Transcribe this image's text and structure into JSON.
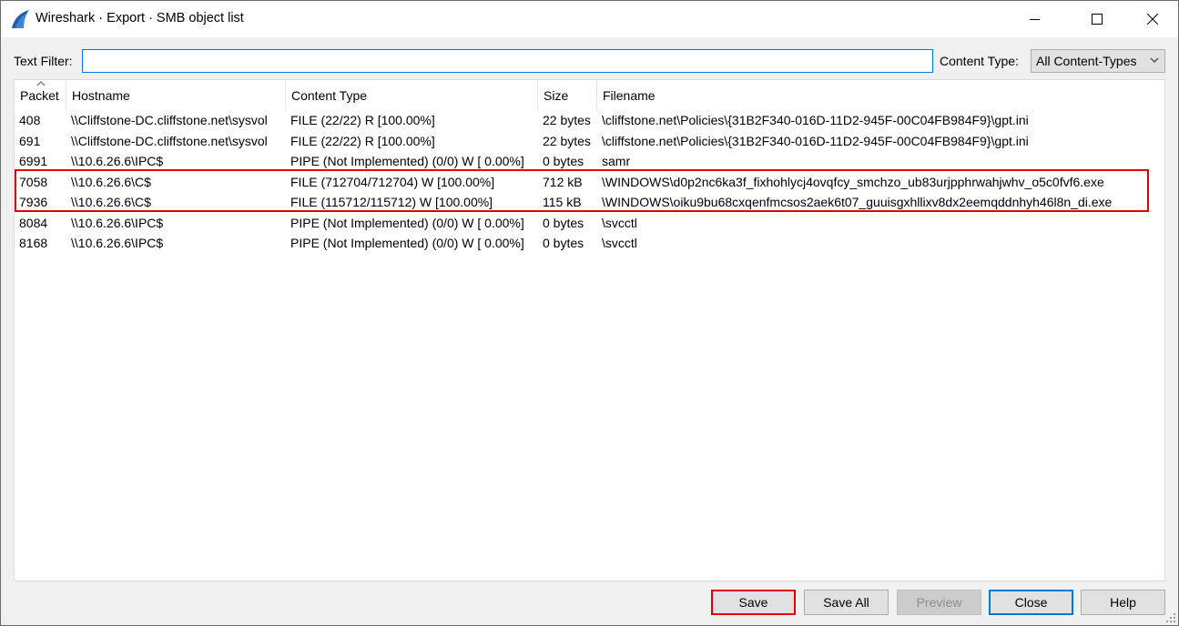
{
  "window": {
    "title": "Wireshark · Export · SMB object list"
  },
  "filter": {
    "text_filter_label": "Text Filter:",
    "text_filter_value": "",
    "content_type_label": "Content Type:",
    "content_type_value": "All Content-Types"
  },
  "table": {
    "columns": [
      "Packet",
      "Hostname",
      "Content Type",
      "Size",
      "Filename"
    ],
    "sorted_column": "Packet",
    "rows": [
      [
        "408",
        "\\\\Cliffstone-DC.cliffstone.net\\sysvol",
        "FILE (22/22) R [100.00%]",
        "22 bytes",
        "\\cliffstone.net\\Policies\\{31B2F340-016D-11D2-945F-00C04FB984F9}\\gpt.ini"
      ],
      [
        "691",
        "\\\\Cliffstone-DC.cliffstone.net\\sysvol",
        "FILE (22/22) R [100.00%]",
        "22 bytes",
        "\\cliffstone.net\\Policies\\{31B2F340-016D-11D2-945F-00C04FB984F9}\\gpt.ini"
      ],
      [
        "6991",
        "\\\\10.6.26.6\\IPC$",
        "PIPE (Not Implemented) (0/0) W [ 0.00%]",
        "0 bytes",
        "samr"
      ],
      [
        "7058",
        "\\\\10.6.26.6\\C$",
        "FILE (712704/712704) W [100.00%]",
        "712 kB",
        "\\WINDOWS\\d0p2nc6ka3f_fixhohlycj4ovqfcy_smchzo_ub83urjpphrwahjwhv_o5c0fvf6.exe"
      ],
      [
        "7936",
        "\\\\10.6.26.6\\C$",
        "FILE (115712/115712) W [100.00%]",
        "115 kB",
        "\\WINDOWS\\oiku9bu68cxqenfmcsos2aek6t07_guuisgxhllixv8dx2eemqddnhyh46l8n_di.exe"
      ],
      [
        "8084",
        "\\\\10.6.26.6\\IPC$",
        "PIPE (Not Implemented) (0/0) W [ 0.00%]",
        "0 bytes",
        "\\svcctl"
      ],
      [
        "8168",
        "\\\\10.6.26.6\\IPC$",
        "PIPE (Not Implemented) (0/0) W [ 0.00%]",
        "0 bytes",
        "\\svcctl"
      ]
    ],
    "highlighted_packets": [
      "7058",
      "7936"
    ]
  },
  "buttons": {
    "save": "Save",
    "save_all": "Save All",
    "preview": "Preview",
    "close": "Close",
    "help": "Help"
  },
  "colors": {
    "highlight_border": "#e00000",
    "focus_border": "#0078d7",
    "app_icon": "#1f5fa8"
  }
}
